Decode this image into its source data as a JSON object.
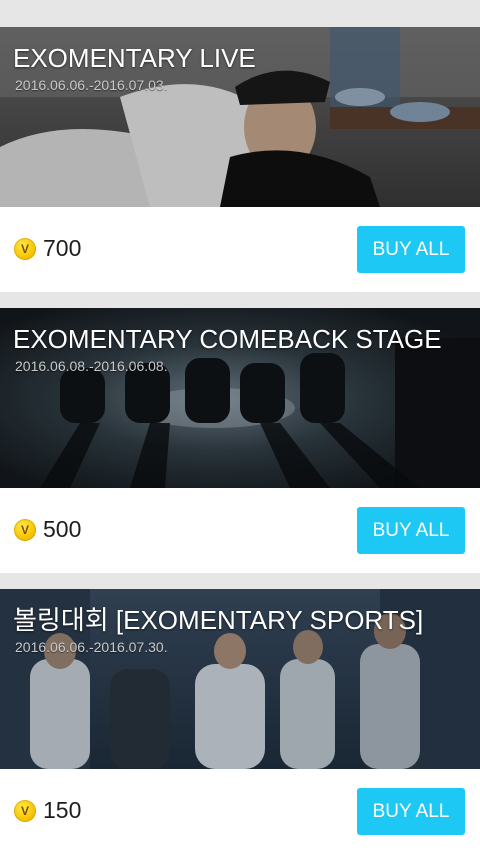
{
  "cards": [
    {
      "title": "EXOMENTARY LIVE",
      "period": "2016.06.06.-2016.07.03.",
      "price": "700",
      "coin_icon": "v-coin-icon",
      "button_label": "BUY ALL"
    },
    {
      "title": "EXOMENTARY COMEBACK STAGE",
      "period": "2016.06.08.-2016.06.08.",
      "price": "500",
      "coin_icon": "v-coin-icon",
      "button_label": "BUY ALL"
    },
    {
      "title": "볼링대회 [EXOMENTARY SPORTS]",
      "period": "2016.06.06.-2016.07.30.",
      "price": "150",
      "coin_icon": "v-coin-icon",
      "button_label": "BUY ALL"
    }
  ],
  "coin_glyph": "V",
  "colors": {
    "button": "#1ec8f5",
    "coin": "#f6c400",
    "separator": "#e6e6e6"
  }
}
